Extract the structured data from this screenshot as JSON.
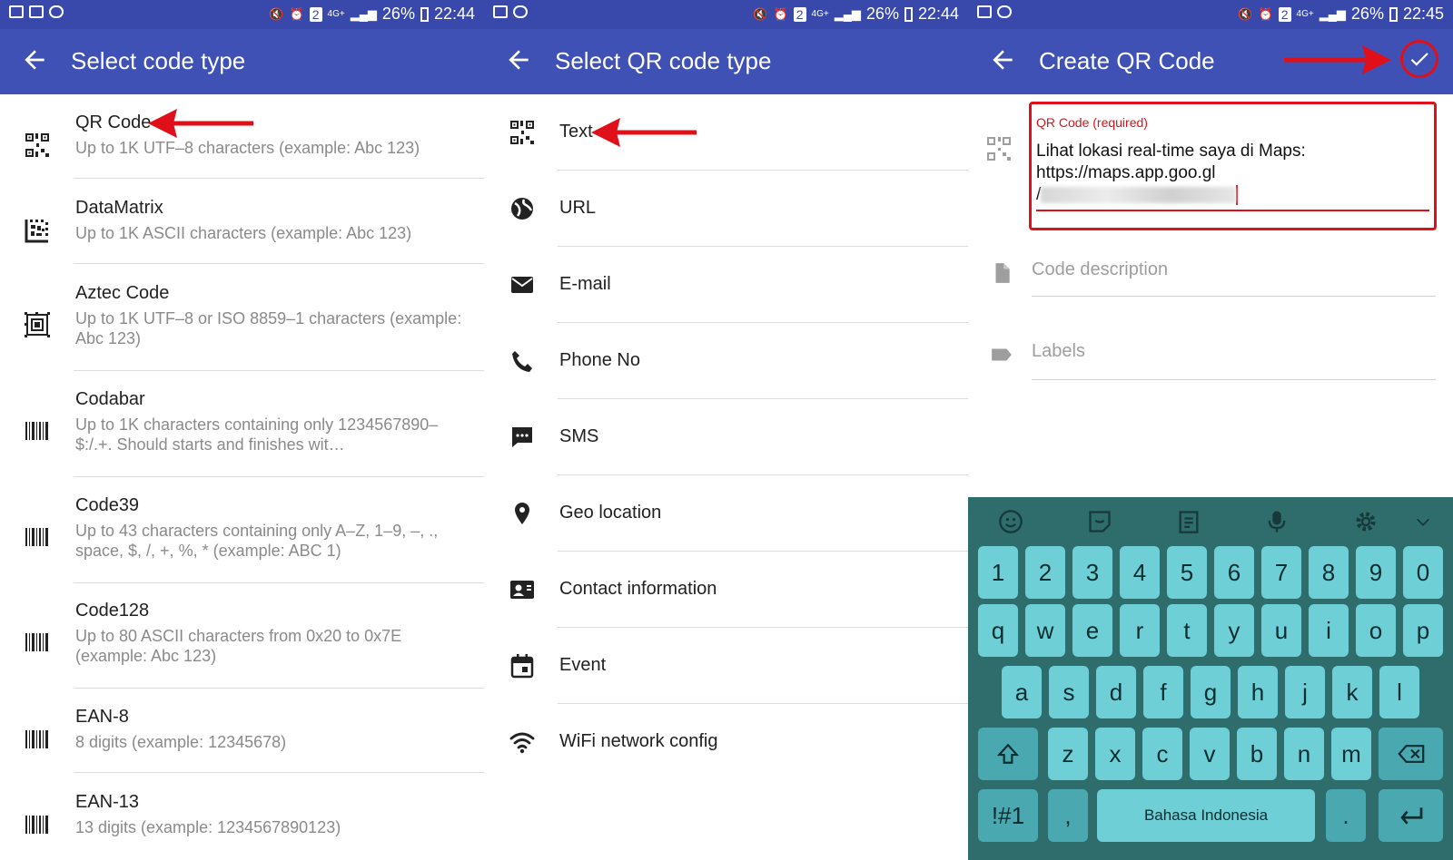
{
  "status_bars": [
    {
      "battery": "26%",
      "time": "22:44",
      "sim": "2",
      "network": "4G+"
    },
    {
      "battery": "26%",
      "time": "22:44",
      "sim": "2",
      "network": "4G+"
    },
    {
      "battery": "26%",
      "time": "22:45",
      "sim": "2",
      "network": "4G+"
    }
  ],
  "panel1": {
    "title": "Select code type",
    "items": [
      {
        "title": "QR Code",
        "desc": "Up to 1K UTF–8 characters (example: Abc 123)",
        "icon": "qr-icon"
      },
      {
        "title": "DataMatrix",
        "desc": "Up to 1K ASCII characters (example: Abc 123)",
        "icon": "datamatrix-icon"
      },
      {
        "title": "Aztec Code",
        "desc": "Up to 1K UTF–8 or ISO 8859–1 characters (example: Abc 123)",
        "icon": "aztec-icon"
      },
      {
        "title": "Codabar",
        "desc": "Up to 1K characters containing only 1234567890–$:/.+. Should starts and finishes wit…",
        "icon": "barcode-icon"
      },
      {
        "title": "Code39",
        "desc": "Up to 43 characters containing only A–Z, 1–9, –, ., space, $, /, +, %, * (example: ABC 1)",
        "icon": "barcode-icon"
      },
      {
        "title": "Code128",
        "desc": "Up to 80 ASCII characters from 0x20 to 0x7E (example: Abc 123)",
        "icon": "barcode-icon"
      },
      {
        "title": "EAN-8",
        "desc": "8 digits (example: 12345678)",
        "icon": "barcode-icon"
      },
      {
        "title": "EAN-13",
        "desc": "13 digits (example: 1234567890123)",
        "icon": "barcode-icon"
      }
    ]
  },
  "panel2": {
    "title": "Select QR code type",
    "items": [
      {
        "title": "Text",
        "icon": "qr-icon"
      },
      {
        "title": "URL",
        "icon": "globe-icon"
      },
      {
        "title": "E-mail",
        "icon": "envelope-icon"
      },
      {
        "title": "Phone No",
        "icon": "phone-icon"
      },
      {
        "title": "SMS",
        "icon": "sms-icon"
      },
      {
        "title": "Geo location",
        "icon": "location-pin-icon"
      },
      {
        "title": "Contact information",
        "icon": "contact-card-icon"
      },
      {
        "title": "Event",
        "icon": "calendar-icon"
      },
      {
        "title": "WiFi network config",
        "icon": "wifi-icon"
      }
    ]
  },
  "panel3": {
    "title": "Create QR Code",
    "qr_label": "QR Code (required)",
    "qr_value_line1": "Lihat lokasi real-time saya di Maps:",
    "qr_value_line2": "https://maps.app.goo.gl",
    "qr_value_line3": "/",
    "description_placeholder": "Code description",
    "labels_placeholder": "Labels"
  },
  "keyboard": {
    "row_numbers": [
      "1",
      "2",
      "3",
      "4",
      "5",
      "6",
      "7",
      "8",
      "9",
      "0"
    ],
    "row1": [
      "q",
      "w",
      "e",
      "r",
      "t",
      "y",
      "u",
      "i",
      "o",
      "p"
    ],
    "row2": [
      "a",
      "s",
      "d",
      "f",
      "g",
      "h",
      "j",
      "k",
      "l"
    ],
    "row3": [
      "z",
      "x",
      "c",
      "v",
      "b",
      "n",
      "m"
    ],
    "symbols": "!#1",
    "comma": ",",
    "space": "Bahasa Indonesia",
    "period": "."
  },
  "colors": {
    "appbar": "#3f51b5",
    "statusbar": "#3949ab",
    "annotation": "#e0101a",
    "keyboard_bg": "#2f6d6d",
    "key": "#6fcfd6"
  }
}
